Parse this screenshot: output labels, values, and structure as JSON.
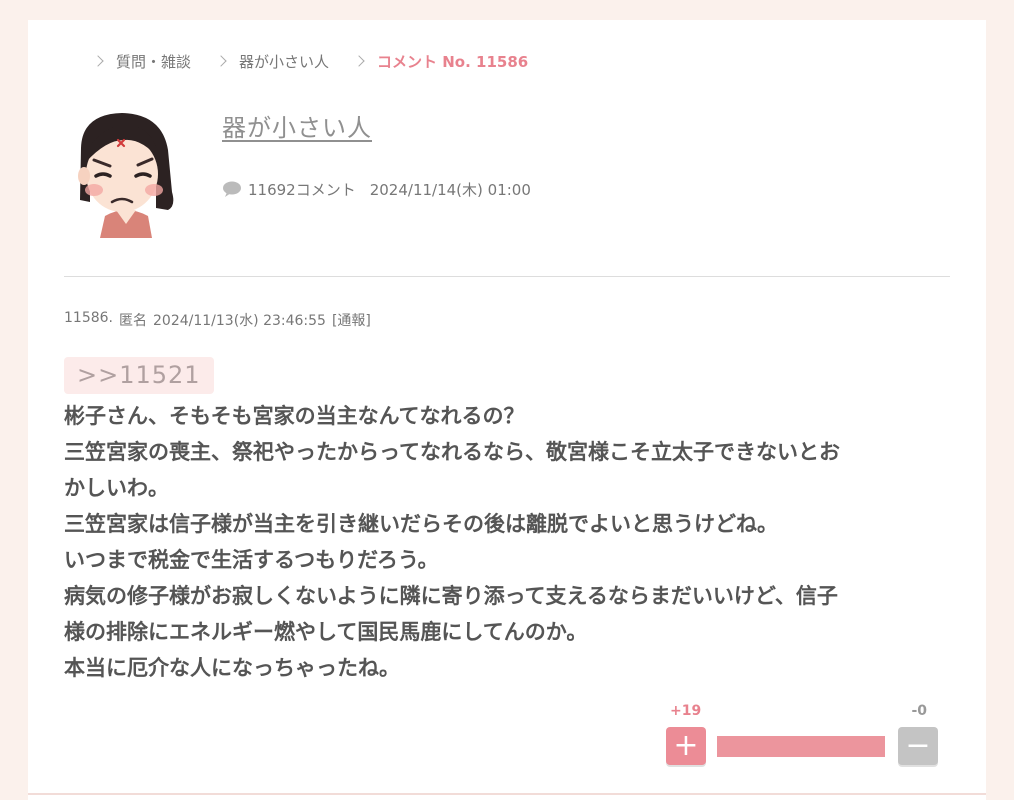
{
  "breadcrumb": {
    "items": [
      "質問・雑談",
      "器が小さい人"
    ],
    "current": "コメント No. 11586"
  },
  "topic": {
    "title": "器が小さい人",
    "comment_count": "11692コメント",
    "date": "2024/11/14(木) 01:00",
    "avatar": "angry-woman-illustration"
  },
  "comment": {
    "number": "11586.",
    "author": "匿名",
    "datetime": "2024/11/13(水) 23:46:55",
    "report": "[通報]",
    "anchor": ">>11521",
    "lines": [
      "彬子さん、そもそも宮家の当主なんてなれるの？",
      "三笠宮家の喪主、祭祀やったからってなれるなら、敬宮様こそ立太子できないとお",
      "かしいわ。",
      "三笠宮家は信子様が当主を引き継いだらその後は離脱でよいと思うけどね。",
      "いつまで税金で生活するつもりだろう。",
      "病気の修子様がお寂しくないように隣に寄り添って支えるならまだいいけど、信子",
      "様の排除にエネルギー燃やして国民馬鹿にしてんのか。",
      "本当に厄介な人になっちゃったね。"
    ]
  },
  "votes": {
    "plus_count": "+19",
    "minus_count": "-0",
    "plus_symbol": "+",
    "minus_symbol": "−",
    "plus_ratio": 1.0
  },
  "colors": {
    "accent": "#e8828e",
    "background": "#fbf1ec"
  }
}
